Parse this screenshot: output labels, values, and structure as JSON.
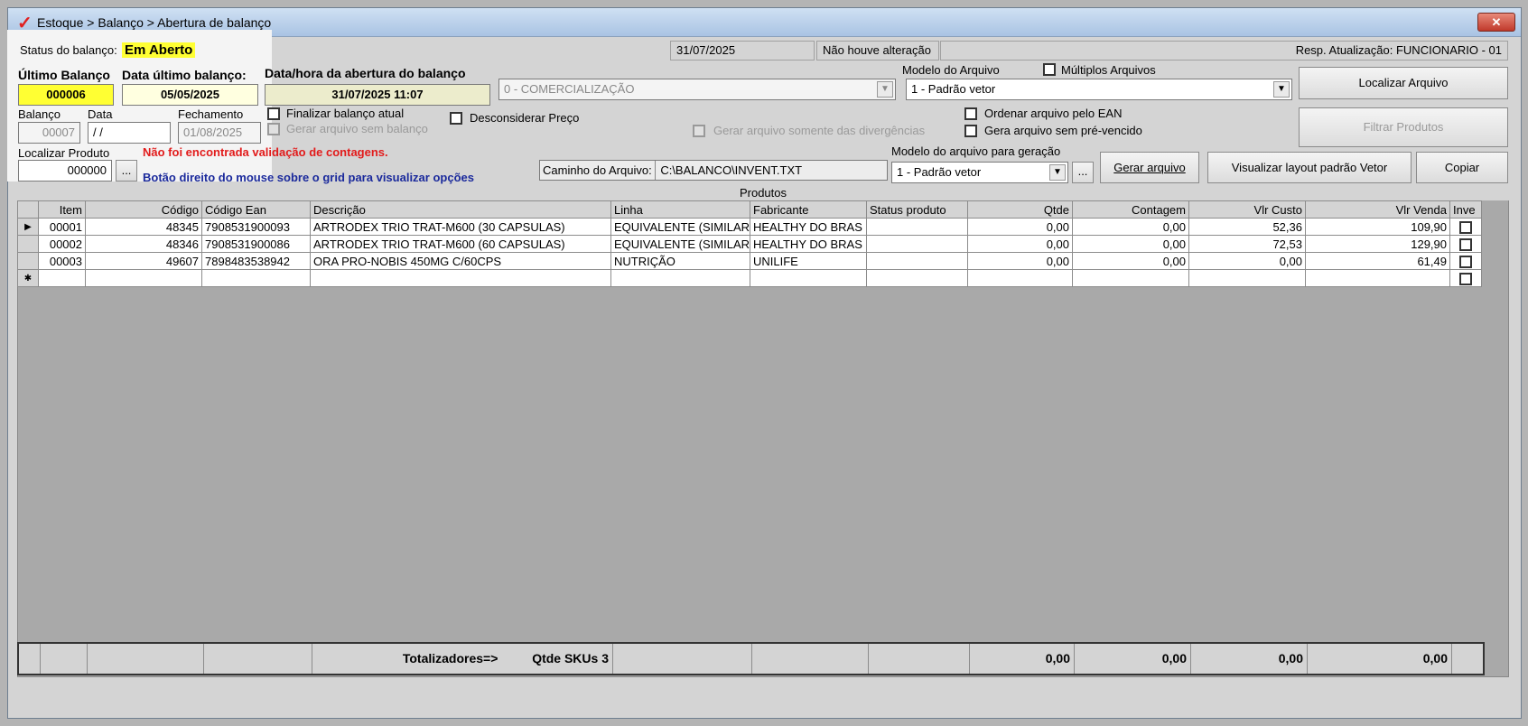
{
  "window": {
    "title": "Estoque > Balanço > Abertura de balanço",
    "close_label": "✕"
  },
  "status": {
    "label": "Status do balanço:",
    "value": "Em Aberto",
    "date": "31/07/2025",
    "change_text": "Não houve alteração",
    "resp_label": "Resp. Atualização: FUNCIONARIO - 01"
  },
  "ultimo_balanco": {
    "label": "Último Balanço",
    "value": "000006"
  },
  "data_ultimo": {
    "label": "Data último balanço:",
    "value": "05/05/2025"
  },
  "abertura": {
    "label": "Data/hora da abertura do balanço",
    "value": "31/07/2025 11:07"
  },
  "comercializacao": {
    "value": "0 - COMERCIALIZAÇÃO"
  },
  "modelo_arquivo": {
    "label": "Modelo do Arquivo",
    "value": "1 - Padrão vetor"
  },
  "multiplos": {
    "label": "Múltiplos Arquivos"
  },
  "balanco": {
    "label": "Balanço",
    "value": "00007"
  },
  "data": {
    "label": "Data",
    "value": "/ /"
  },
  "fechamento": {
    "label": "Fechamento",
    "value": "01/08/2025"
  },
  "checks": {
    "finalizar": "Finalizar balanço atual",
    "gerar_sem_balanco": "Gerar arquivo sem balanço",
    "desconsiderar": "Desconsiderar Preço",
    "somente_divergencias": "Gerar arquivo somente das divergências",
    "ordenar_ean": "Ordenar arquivo pelo EAN",
    "sem_prevencido": "Gera arquivo sem pré-vencido"
  },
  "buttons": {
    "localizar_arquivo": "Localizar Arquivo",
    "filtrar_produtos": "Filtrar Produtos",
    "ellipsis": "...",
    "gerar_arquivo": "Gerar arquivo",
    "visualizar_layout": "Visualizar layout padrão Vetor",
    "copiar": "Copiar"
  },
  "localizar": {
    "label": "Localizar Produto",
    "value": "000000"
  },
  "messages": {
    "validacao": "Não foi encontrada validação de contagens.",
    "dica": "Botão direito do mouse sobre o grid para visualizar opções"
  },
  "caminho": {
    "label": "Caminho do Arquivo:",
    "value": "C:\\BALANCO\\INVENT.TXT"
  },
  "modelo_geracao": {
    "label": "Modelo do arquivo para geração",
    "value": "1 - Padrão vetor"
  },
  "grid": {
    "caption": "Produtos",
    "columns": [
      "Item",
      "Código",
      "Código Ean",
      "Descrição",
      "Linha",
      "Fabricante",
      "Status produto",
      "Qtde",
      "Contagem",
      "Vlr Custo",
      "Vlr Venda",
      "Inve"
    ],
    "rows": [
      [
        "00001",
        "48345",
        "7908531900093",
        "ARTRODEX TRIO TRAT-M600 (30 CAPSULAS)",
        "EQUIVALENTE (SIMILAR",
        "HEALTHY DO BRAS",
        "",
        "0,00",
        "0,00",
        "52,36",
        "109,90"
      ],
      [
        "00002",
        "48346",
        "7908531900086",
        "ARTRODEX TRIO TRAT-M600 (60 CAPSULAS)",
        "EQUIVALENTE (SIMILAR",
        "HEALTHY DO BRAS",
        "",
        "0,00",
        "0,00",
        "72,53",
        "129,90"
      ],
      [
        "00003",
        "49607",
        "7898483538942",
        "ORA PRO-NOBIS 450MG C/60CPS",
        "NUTRIÇÃO",
        "UNILIFE",
        "",
        "0,00",
        "0,00",
        "0,00",
        "61,49"
      ]
    ],
    "current_row_marker": "▶",
    "new_row_marker": "✱"
  },
  "totals": {
    "label": "Totalizadores=>",
    "skus": "Qtde SKUs 3",
    "qtde": "0,00",
    "contagem": "0,00",
    "custo": "0,00",
    "venda": "0,00"
  }
}
